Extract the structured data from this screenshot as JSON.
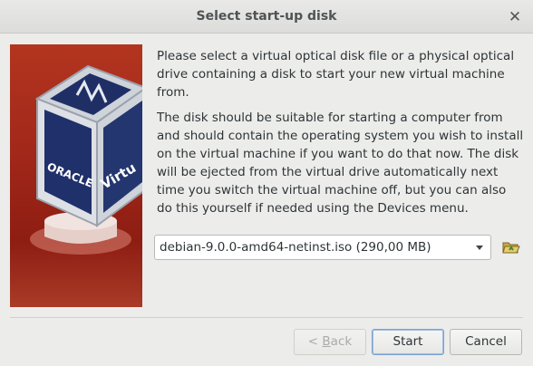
{
  "window": {
    "title": "Select start-up disk",
    "close_icon": "close-icon"
  },
  "logo": {
    "brand_text": "ORACLE",
    "side_text": "Virtu",
    "icon": "virtualbox-logo"
  },
  "main": {
    "paragraph1": "Please select a virtual optical disk file or a physical optical drive containing a disk to start your new virtual machine from.",
    "paragraph2": "The disk should be suitable for starting a computer from and should contain the operating system you wish to install on the virtual machine if you want to do that now. The disk will be ejected from the virtual drive automatically next time you switch the virtual machine off, but you can also do this yourself if needed using the Devices menu."
  },
  "disk_select": {
    "selected": "debian-9.0.0-amd64-netinst.iso (290,00 MB)",
    "folder_icon": "folder-open-icon"
  },
  "buttons": {
    "back_prefix": "< ",
    "back_mnemonic": "B",
    "back_rest": "ack",
    "start": "Start",
    "cancel": "Cancel"
  },
  "colors": {
    "logo_background": "#a2281a",
    "default_button_border": "#7aa2cf"
  }
}
